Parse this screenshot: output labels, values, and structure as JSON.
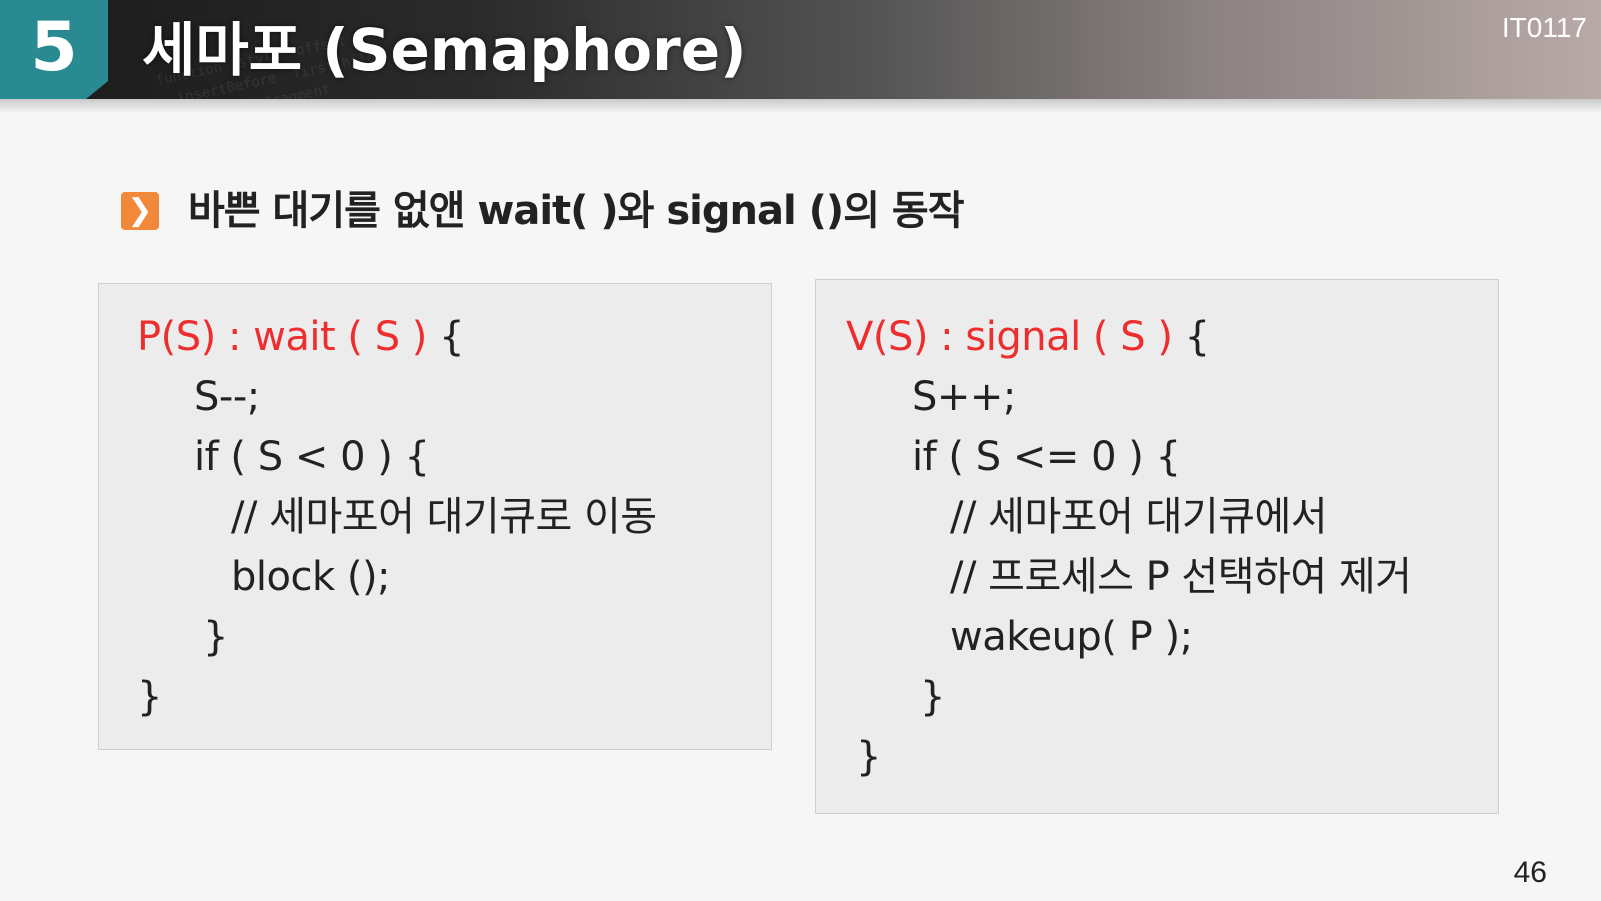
{
  "header": {
    "section_number": "5",
    "title": "세마포 (Semaphore)",
    "course_code": "IT0117"
  },
  "subtitle": "바쁜 대기를 없앤 wait( )와 signal ()의 동작",
  "left_code": {
    "line1_red": "P(S) : wait ( S )",
    "line1_rest": " {",
    "lines": [
      "S--;",
      "if ( S < 0 ) {",
      "// 세마포어 대기큐로 이동",
      "block ();",
      "}",
      "}"
    ]
  },
  "right_code": {
    "line1_red": "V(S) : signal ( S )",
    "line1_rest": " {",
    "lines": [
      "S++;",
      "if ( S <= 0 ) {",
      "// 세마포어 대기큐에서",
      "// 프로세스 P 선택하여 제거",
      "wakeup( P );",
      "}",
      "}"
    ]
  },
  "page_number": "46",
  "colors": {
    "accent_teal": "#2a8a91",
    "bullet_orange": "#f08a3a",
    "code_red": "#ee2e2e"
  }
}
